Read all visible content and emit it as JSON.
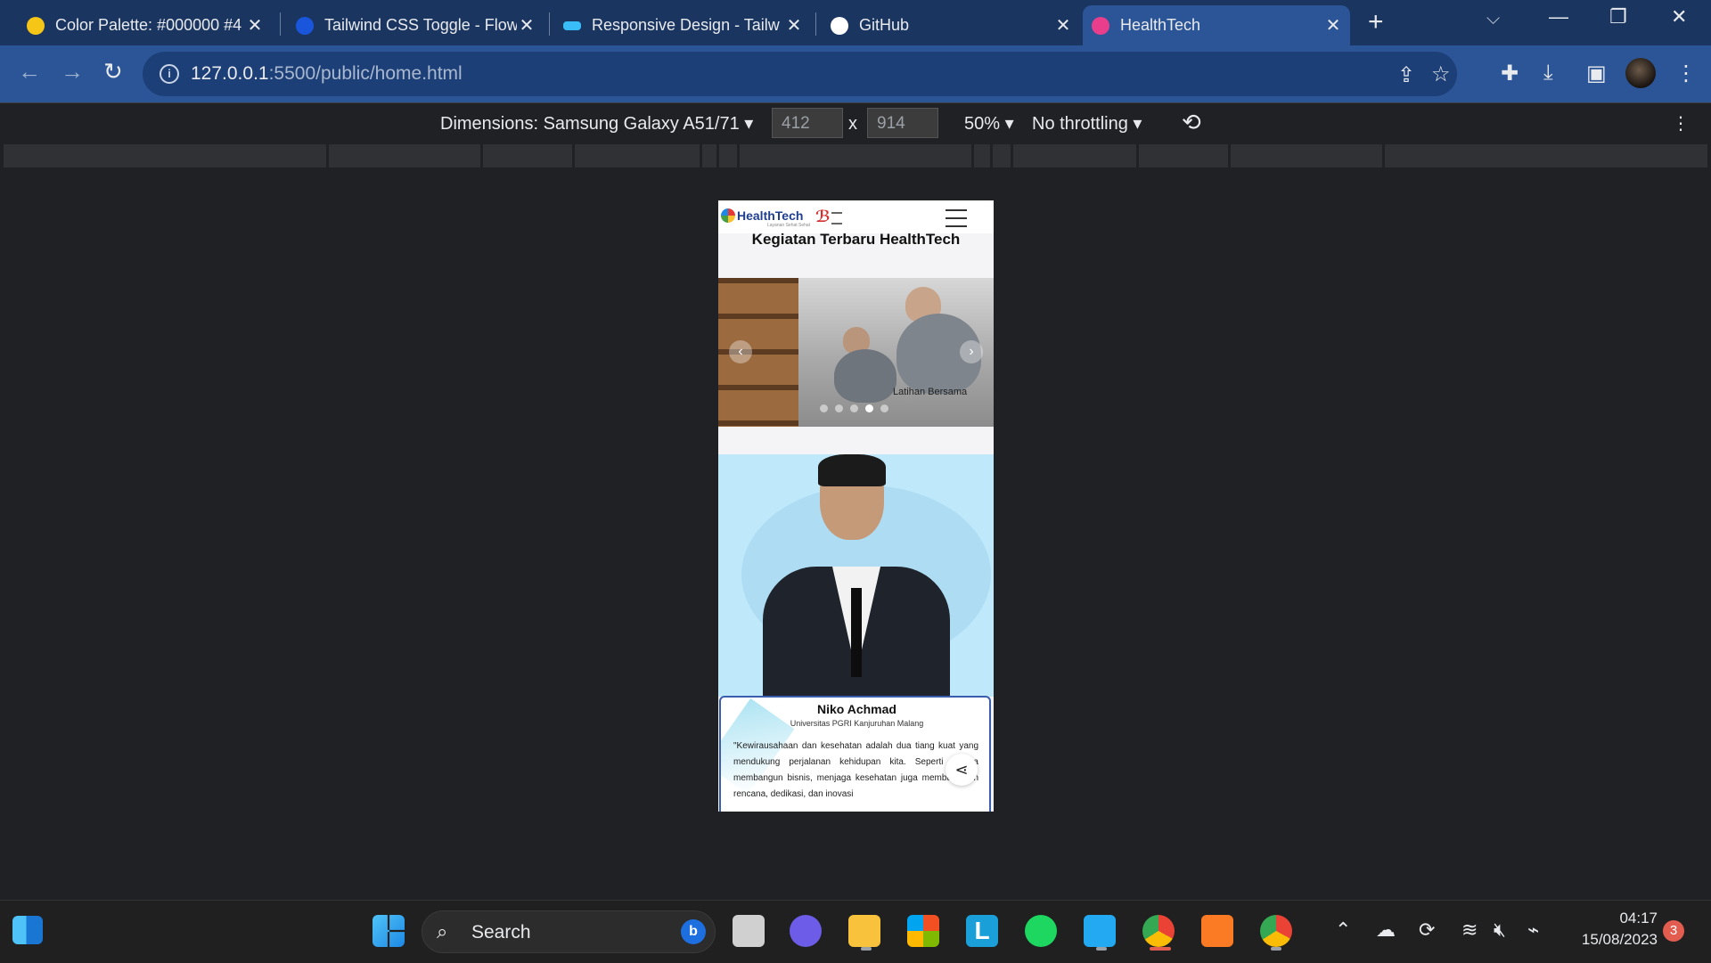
{
  "browser": {
    "tabs": [
      {
        "title": "Color Palette: #000000 #4",
        "favicon_color": "#f5c518"
      },
      {
        "title": "Tailwind CSS Toggle - Flow",
        "favicon_color": "#1a56db"
      },
      {
        "title": "Responsive Design - Tailw",
        "favicon_color": "#38bdf8"
      },
      {
        "title": "GitHub",
        "favicon_color": "#ffffff"
      },
      {
        "title": "HealthTech",
        "favicon_color": "#e83e8c",
        "active": true
      }
    ],
    "new_tab_icon": "plus-icon",
    "url_host": "127.0.0.1",
    "url_path": ":5500/public/home.html"
  },
  "devtools": {
    "dimensions_label": "Dimensions: Samsung Galaxy A51/71",
    "width": "412",
    "height": "914",
    "times": "x",
    "zoom": "50%",
    "throttling": "No throttling"
  },
  "page": {
    "brand": "HealthTech",
    "brand_sub": "Layanan Sehat Sehat",
    "heading": "Kegiatan Terbaru HealthTech",
    "carousel": {
      "caption": "Latihan Bersama",
      "prev": "‹",
      "next": "›",
      "slides": 5,
      "active_slide": 4
    },
    "profile": {
      "name": "Niko Achmad",
      "university": "Universitas PGRI Kanjuruhan Malang",
      "quote": "\"Kewirausahaan dan kesehatan adalah dua tiang kuat yang mendukung perjalanan kehidupan kita. Seperti halnya membangun bisnis, menjaga kesehatan juga membutuhkan rencana, dedikasi, dan inovasi"
    }
  },
  "taskbar": {
    "search_label": "Search",
    "time": "04:17",
    "date": "15/08/2023",
    "notifications": "3"
  },
  "colors": {
    "tabstrip": "#1a3560",
    "toolbar": "#2b5596",
    "devtools_bg": "#202124",
    "accent_border": "#3b5dae"
  }
}
